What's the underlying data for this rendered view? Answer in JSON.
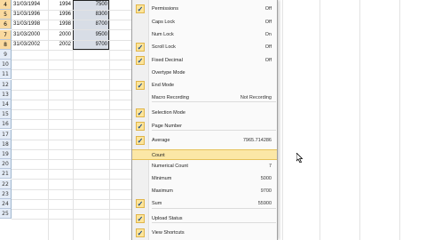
{
  "sheet": {
    "rows": [
      {
        "num": "4",
        "date": "31/03/1994",
        "year": "1994",
        "value": "7500"
      },
      {
        "num": "5",
        "date": "31/03/1996",
        "year": "1996",
        "value": "8300"
      },
      {
        "num": "6",
        "date": "31/03/1998",
        "year": "1998",
        "value": "8700"
      },
      {
        "num": "7",
        "date": "31/03/2000",
        "year": "2000",
        "value": "9500"
      },
      {
        "num": "8",
        "date": "31/03/2002",
        "year": "2002",
        "value": "9700"
      },
      {
        "num": "9"
      },
      {
        "num": "10"
      },
      {
        "num": "11"
      },
      {
        "num": "12"
      },
      {
        "num": "13"
      },
      {
        "num": "14"
      },
      {
        "num": "15"
      },
      {
        "num": "16"
      },
      {
        "num": "17"
      },
      {
        "num": "18"
      },
      {
        "num": "19"
      },
      {
        "num": "20"
      },
      {
        "num": "21"
      },
      {
        "num": "22"
      },
      {
        "num": "23"
      },
      {
        "num": "24"
      },
      {
        "num": "25"
      }
    ]
  },
  "menu": {
    "items": [
      {
        "label": "Permissions",
        "value": "Off",
        "checked": true
      },
      {
        "label": "Caps Lock",
        "value": "Off",
        "checked": false
      },
      {
        "label": "Num Lock",
        "value": "On",
        "checked": false
      },
      {
        "label": "Scroll Lock",
        "value": "Off",
        "checked": true
      },
      {
        "label": "Fixed Decimal",
        "value": "Off",
        "checked": true
      },
      {
        "label": "Overtype Mode",
        "value": "",
        "checked": false
      },
      {
        "label": "End Mode",
        "value": "",
        "checked": true
      },
      {
        "label": "Macro Recording",
        "value": "Not Recording",
        "checked": false
      },
      {
        "label": "Selection Mode",
        "value": "",
        "checked": true
      },
      {
        "label": "Page Number",
        "value": "",
        "checked": true
      },
      {
        "label": "Average",
        "value": "7965.714286",
        "checked": true
      },
      {
        "label": "Count",
        "value": "",
        "checked": false,
        "highlighted": true
      },
      {
        "label": "Numerical Count",
        "value": "7",
        "checked": false
      },
      {
        "label": "Minimum",
        "value": "5000",
        "checked": false
      },
      {
        "label": "Maximum",
        "value": "9700",
        "checked": false
      },
      {
        "label": "Sum",
        "value": "55900",
        "checked": true
      },
      {
        "label": "Upload Status",
        "value": "",
        "checked": true
      },
      {
        "label": "View Shortcuts",
        "value": "",
        "checked": true
      }
    ]
  }
}
